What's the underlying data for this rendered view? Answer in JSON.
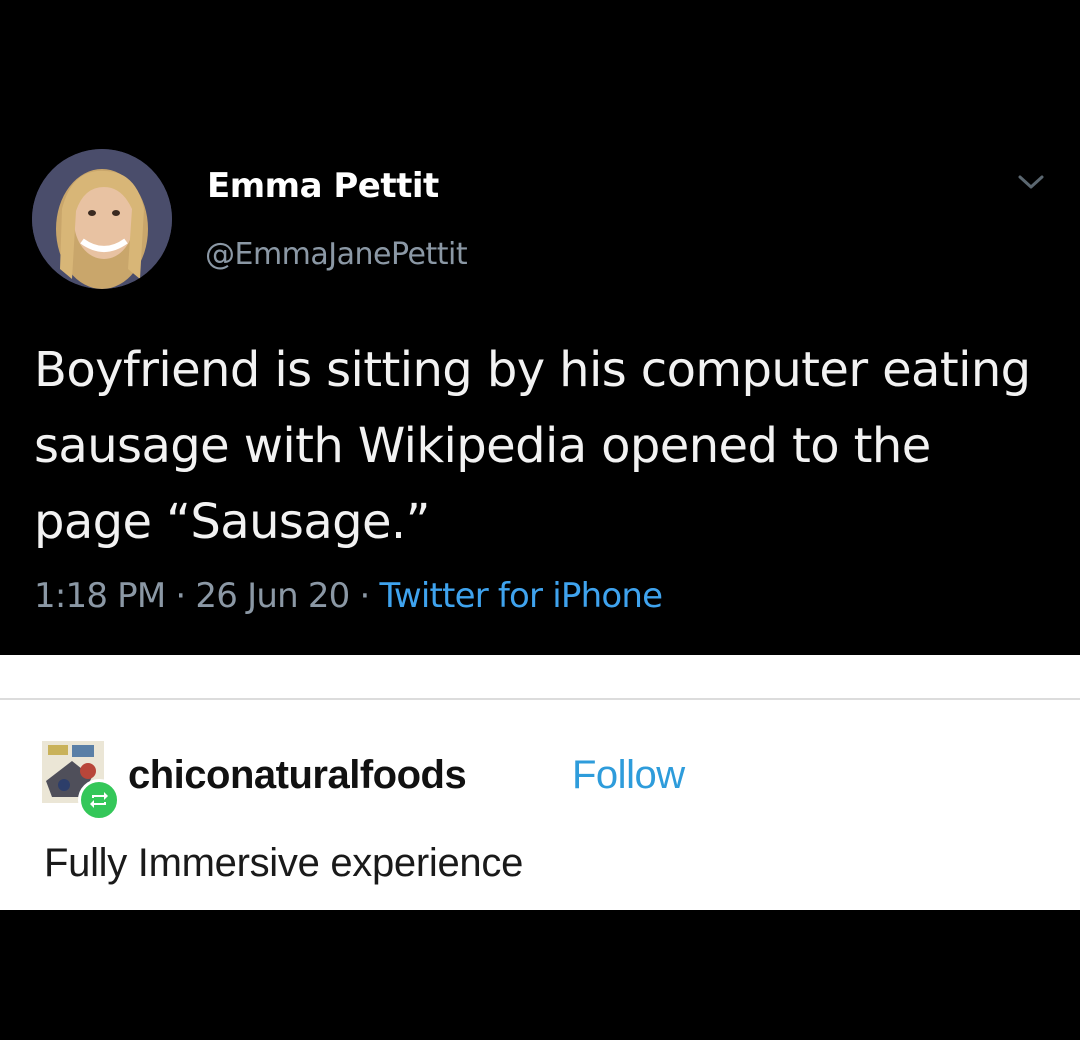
{
  "tweet": {
    "display_name": "Emma Pettit",
    "handle": "@EmmaJanePettit",
    "text": "Boyfriend is sitting by his computer eating sausage with Wikipedia opened to the page “Sausage.”",
    "timestamp": "1:18 PM · 26 Jun 20 · ",
    "source": "Twitter for iPhone",
    "icons": {
      "avatar": "profile-photo",
      "menu": "chevron-down-icon"
    }
  },
  "tumblr": {
    "username": "chiconaturalfoods",
    "follow_label": "Follow",
    "caption": "Fully Immersive experience",
    "icons": {
      "avatar": "blog-avatar",
      "badge": "reblog-icon"
    },
    "colors": {
      "follow": "#2e9cdb",
      "badge": "#34c759"
    }
  }
}
